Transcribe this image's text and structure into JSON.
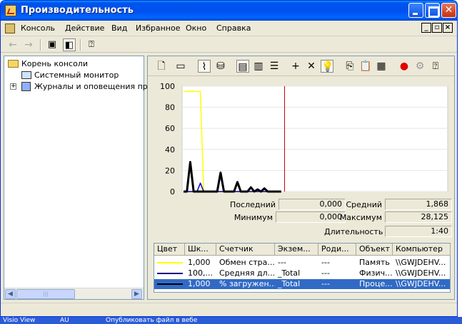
{
  "window": {
    "title": "Производительность"
  },
  "menu": {
    "items": [
      "Консоль",
      "Действие",
      "Вид",
      "Избранное",
      "Окно",
      "Справка"
    ],
    "mdi_min": "_",
    "mdi_restore": "▫",
    "mdi_close": "×"
  },
  "tree": {
    "root": "Корень консоли",
    "system_monitor": "Системный монитор",
    "logs": "Журналы и оповещения прои",
    "expand": "+"
  },
  "graph": {
    "y_ticks": [
      "100",
      "80",
      "60",
      "40",
      "20",
      "0"
    ]
  },
  "stats": {
    "last_label": "Последний",
    "last_value": "0,000",
    "avg_label": "Средний",
    "avg_value": "1,868",
    "min_label": "Минимум",
    "min_value": "0,000",
    "max_label": "Максимум",
    "max_value": "28,125",
    "duration_label": "Длительность",
    "duration_value": "1:40"
  },
  "counters": {
    "headers": [
      "Цвет",
      "Шк...",
      "Счетчик",
      "Экзем...",
      "Роди...",
      "Объект",
      "Компьютер"
    ],
    "rows": [
      {
        "color": "#ffff00",
        "scale": "1,000",
        "counter": "Обмен стра...",
        "instance": "---",
        "parent": "---",
        "object": "Память",
        "computer": "\\\\GWJDEHV..."
      },
      {
        "color": "#000080",
        "scale": "100,...",
        "counter": "Средняя дл...",
        "instance": "_Total",
        "parent": "---",
        "object": "Физич...",
        "computer": "\\\\GWJDEHV..."
      },
      {
        "color": "#000000",
        "scale": "1,000",
        "counter": "% загружен...",
        "instance": "_Total",
        "parent": "---",
        "object": "Проце...",
        "computer": "\\\\GWJDEHV..."
      }
    ]
  },
  "taskbar": {
    "item1": "Visio View",
    "item2": "AU",
    "item3": "Опубликовать файл в вебе"
  },
  "chart_data": {
    "type": "line",
    "ylim": [
      0,
      100
    ],
    "y_ticks": [
      100,
      80,
      60,
      40,
      20,
      0
    ],
    "grid": true,
    "series": [
      {
        "color": "#ffff00",
        "values": [
          95,
          95,
          95,
          95,
          95,
          95,
          0,
          0,
          0,
          0,
          0,
          0,
          0,
          0,
          0,
          0,
          0,
          0,
          0,
          0,
          0,
          0,
          0,
          0,
          0,
          0,
          0,
          0,
          0,
          0
        ]
      },
      {
        "color": "#0000c0",
        "values": [
          0,
          0,
          0,
          0,
          0,
          8,
          0,
          0,
          0,
          0,
          0,
          0,
          0,
          0,
          0,
          0,
          0,
          0,
          0,
          0,
          0,
          0,
          0,
          0,
          0,
          0,
          0,
          0,
          0,
          0
        ]
      },
      {
        "color": "#000000",
        "values": [
          0,
          0,
          28,
          0,
          0,
          0,
          0,
          0,
          0,
          0,
          0,
          18,
          0,
          0,
          0,
          0,
          9,
          0,
          0,
          0,
          4,
          0,
          2,
          0,
          3,
          0,
          0,
          0,
          0,
          0
        ]
      }
    ],
    "cursor_index": 30,
    "samples": 30
  }
}
